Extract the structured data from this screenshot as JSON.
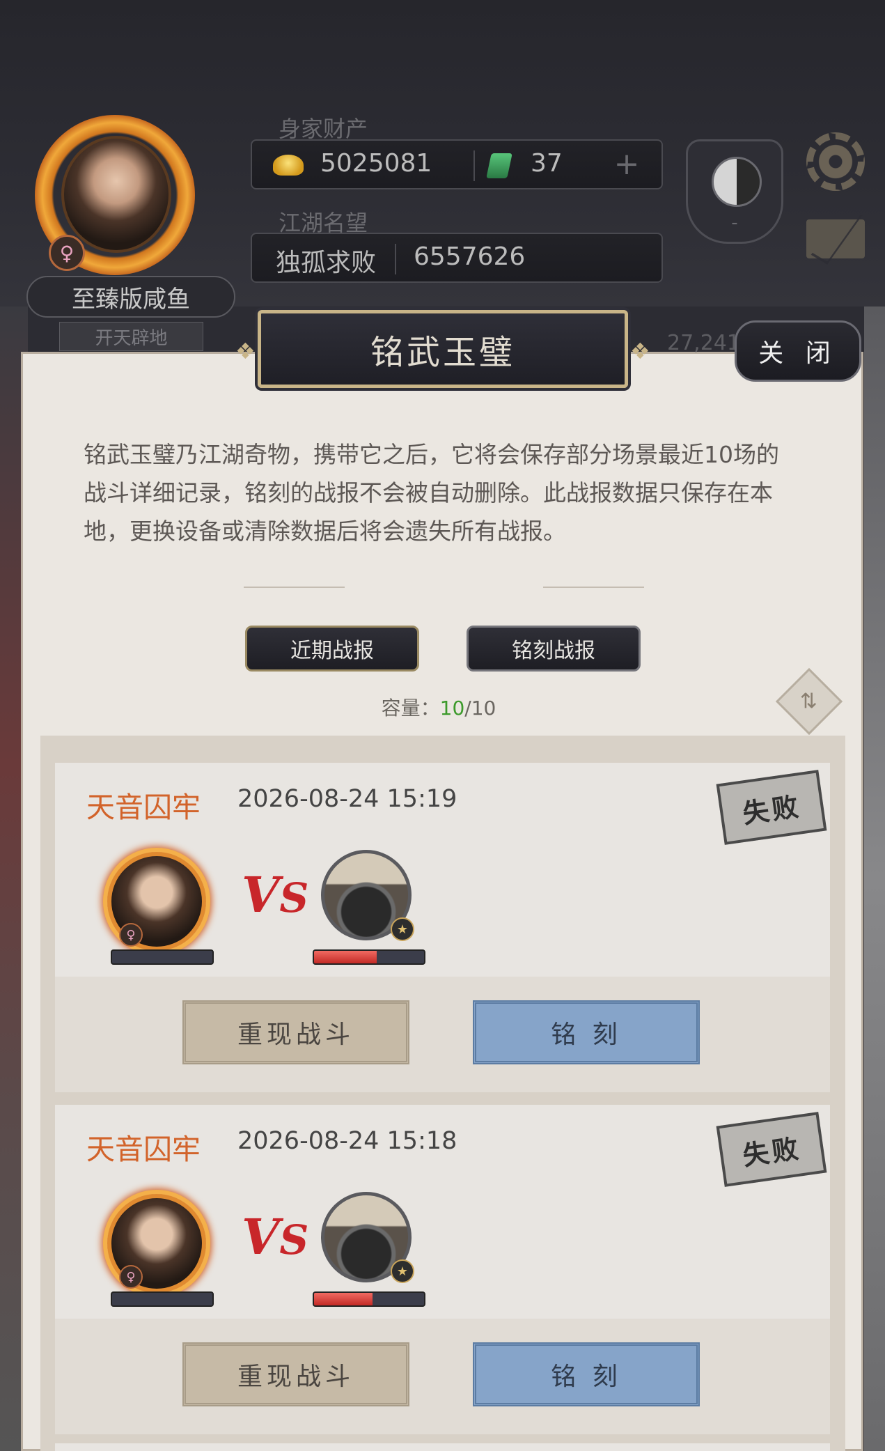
{
  "header": {
    "nickname": "至臻版咸鱼",
    "title_badge": "开天辟地",
    "wealth_label": "身家财产",
    "gold": "5025081",
    "jade": "37",
    "reputation_label": "江湖名望",
    "reputation_title": "独孤求败",
    "reputation_value": "6557626",
    "badge_text": "-",
    "side_number": "27,241"
  },
  "icons": {
    "avatar": "player-avatar",
    "gender": "♀",
    "settings": "gear-icon",
    "mail": "mail-icon",
    "taiji": "taiji-icon",
    "refresh": "refresh-icon"
  },
  "panel": {
    "title": "铭武玉璧",
    "close_label": "关 闭",
    "description": "铭武玉璧乃江湖奇物，携带它之后，它将会保存部分场景最近10场的战斗详细记录，铭刻的战报不会被自动删除。此战报数据只保存在本地，更换设备或清除数据后将会遗失所有战报。",
    "tabs": [
      {
        "label": "近期战报",
        "active": true
      },
      {
        "label": "铭刻战报",
        "active": false
      }
    ],
    "capacity_label": "容量：",
    "capacity_current": "10",
    "capacity_max": "/10"
  },
  "reports": [
    {
      "scene": "天音囚牢",
      "time": "2026-08-24 15:19",
      "result": "失败",
      "vs": "VS",
      "player_hp": 0.0,
      "enemy_hp": 0.57,
      "replay_label": "重现战斗",
      "engrave_label": "铭 刻"
    },
    {
      "scene": "天音囚牢",
      "time": "2026-08-24 15:18",
      "result": "失败",
      "vs": "VS",
      "player_hp": 0.0,
      "enemy_hp": 0.53,
      "replay_label": "重现战斗",
      "engrave_label": "铭 刻"
    }
  ],
  "colors": {
    "scene_name": "#d2632a",
    "capacity_current": "#3c9a2b",
    "hp_fill": "#e0453f",
    "engrave_button": "#86a4c9",
    "replay_button": "#c6baa6"
  }
}
